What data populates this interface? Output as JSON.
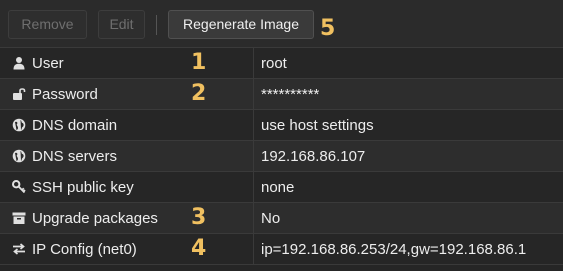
{
  "toolbar": {
    "remove_label": "Remove",
    "edit_label": "Edit",
    "regenerate_label": "Regenerate Image",
    "regenerate_badge": "5"
  },
  "rows": [
    {
      "icon": "user-icon",
      "key": "User",
      "value": "root",
      "badge": "1"
    },
    {
      "icon": "unlock-icon",
      "key": "Password",
      "value": "**********",
      "badge": "2"
    },
    {
      "icon": "globe-icon",
      "key": "DNS domain",
      "value": "use host settings",
      "badge": ""
    },
    {
      "icon": "globe-icon",
      "key": "DNS servers",
      "value": "192.168.86.107",
      "badge": ""
    },
    {
      "icon": "key-icon",
      "key": "SSH public key",
      "value": "none",
      "badge": ""
    },
    {
      "icon": "archive-icon",
      "key": "Upgrade packages",
      "value": "No",
      "badge": "3"
    },
    {
      "icon": "exchange-icon",
      "key": "IP Config (net0)",
      "value": "ip=192.168.86.253/24,gw=192.168.86.1",
      "badge": "4"
    }
  ],
  "colors": {
    "background": "#262626",
    "badge": "#f0c060",
    "text": "#ededed"
  }
}
